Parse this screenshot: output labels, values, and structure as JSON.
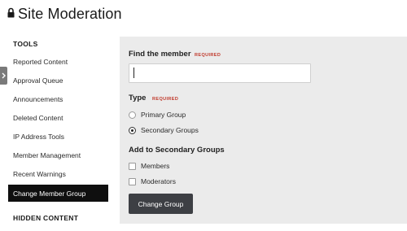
{
  "page": {
    "title": "Site Moderation",
    "title_icon": "lock-icon"
  },
  "sidebar": {
    "tools_heading": "TOOLS",
    "items": [
      {
        "label": "Reported Content"
      },
      {
        "label": "Approval Queue"
      },
      {
        "label": "Announcements"
      },
      {
        "label": "Deleted Content"
      },
      {
        "label": "IP Address Tools"
      },
      {
        "label": "Member Management"
      },
      {
        "label": "Recent Warnings"
      },
      {
        "label": "Change Member Group",
        "active": true
      }
    ],
    "hidden_heading": "HIDDEN CONTENT",
    "collapse_icon": "chevron-right-icon"
  },
  "form": {
    "find_member_label": "Find the member",
    "required_tag": "REQUIRED",
    "member_input_value": "",
    "type_label": "Type",
    "type_options": [
      {
        "label": "Primary Group",
        "checked": false
      },
      {
        "label": "Secondary Groups",
        "checked": true
      }
    ],
    "add_groups_label": "Add to Secondary Groups",
    "group_options": [
      {
        "label": "Members",
        "checked": false
      },
      {
        "label": "Moderators",
        "checked": false
      }
    ],
    "submit_label": "Change Group"
  },
  "colors": {
    "active_item_bg": "#0f0f0f",
    "panel_bg": "#ebebeb",
    "required": "#c0392b",
    "button_bg": "#3d3f44"
  }
}
